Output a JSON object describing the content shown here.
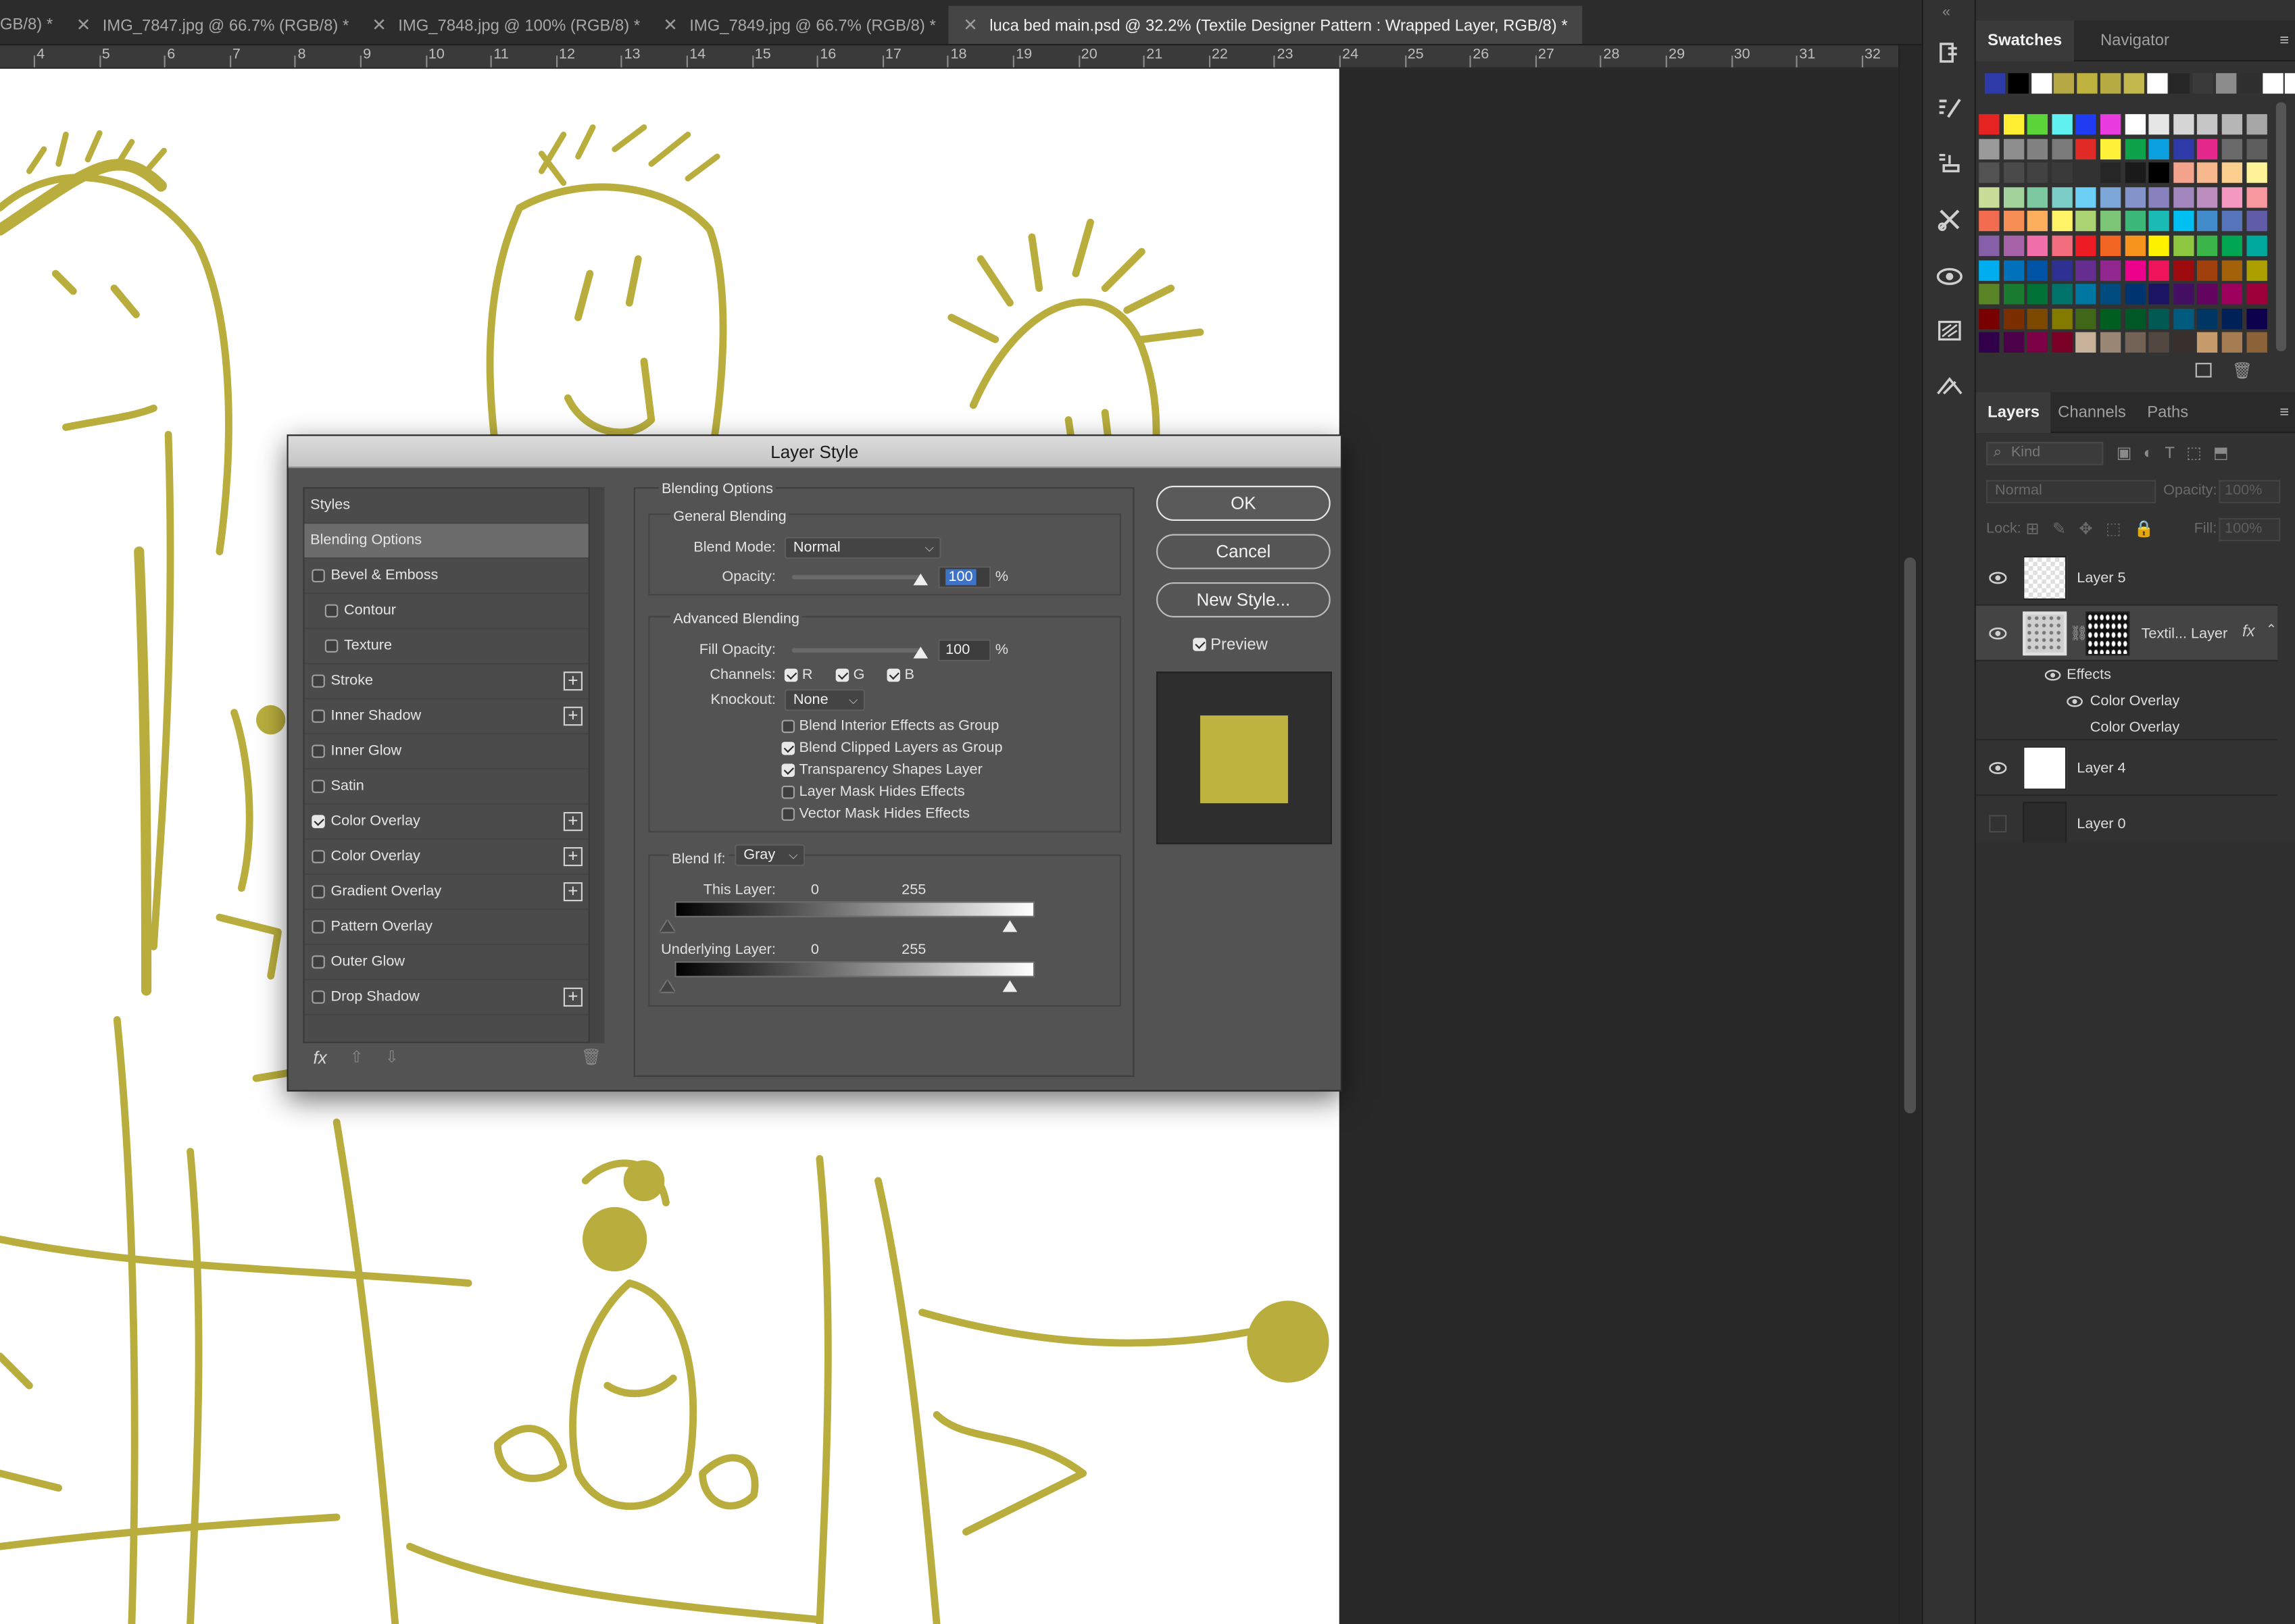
{
  "tabs": [
    {
      "label": "GB/8) *"
    },
    {
      "label": "IMG_7847.jpg @ 66.7% (RGB/8) *"
    },
    {
      "label": "IMG_7848.jpg @ 100% (RGB/8) *"
    },
    {
      "label": "IMG_7849.jpg @ 66.7% (RGB/8) *"
    },
    {
      "label": "luca bed main.psd @ 32.2% (Textile Designer Pattern : Wrapped Layer, RGB/8) *"
    }
  ],
  "ruler": [
    "4",
    "5",
    "6",
    "7",
    "8",
    "9",
    "10",
    "11",
    "12",
    "13",
    "14",
    "15",
    "16",
    "17",
    "18",
    "19",
    "20",
    "21",
    "22",
    "23",
    "24",
    "25",
    "26",
    "27",
    "28",
    "29",
    "30",
    "31",
    "32"
  ],
  "colors": {
    "drawing": "#b9ae3d",
    "overlay": "#bfb33f",
    "dialog_bg": "#535353",
    "panel_bg": "#323232"
  },
  "top_panel": {
    "tabs": [
      "Swatches",
      "Navigator"
    ]
  },
  "swatches": {
    "recent": [
      "#2d3aa8",
      "#000000",
      "#ffffff",
      "#b5a845",
      "#bfb33f",
      "#b7ab44",
      "#c2b84e",
      "#ffffff",
      "#262626",
      "#3a3a3a",
      "#8c8c8c",
      "#2f2f2f",
      "#ffffff",
      "#ffffff"
    ],
    "rows": [
      [
        "#e52421",
        "#ffee32",
        "#5bd43a",
        "#5ff0f0",
        "#1f3cf2",
        "#e93cdf",
        "#ffffff",
        "#e6e6e6",
        "#d6d6d6",
        "#c6c6c6",
        "#b6b6b6",
        "#a6a6a6"
      ],
      [
        "#9a9a9a",
        "#8e8e8e",
        "#828282",
        "#7a7a7a",
        "#df2a26",
        "#fff13a",
        "#0da34a",
        "#0aa0df",
        "#2d3aa8",
        "#e5298c",
        "#6a6a6a",
        "#5e5e5e"
      ],
      [
        "#525252",
        "#4a4a4a",
        "#424242",
        "#3a3a3a",
        "#323232",
        "#262626",
        "#1a1a1a",
        "#000000",
        "#f4a48c",
        "#f6b88c",
        "#fccf8e",
        "#fff39a"
      ],
      [
        "#c8de98",
        "#a2d39c",
        "#7cc9a0",
        "#7ccdc8",
        "#6dcff6",
        "#7da7d9",
        "#8493ca",
        "#8781bd",
        "#a187be",
        "#bc8dbf",
        "#f49ac1",
        "#f6989d"
      ],
      [
        "#f26c4f",
        "#f68e55",
        "#fbaf5c",
        "#fff467",
        "#acd372",
        "#7cc576",
        "#3bb878",
        "#1abbb4",
        "#00bff3",
        "#438ccb",
        "#5674b9",
        "#605ca8"
      ],
      [
        "#855fa8",
        "#a763a8",
        "#f06ea9",
        "#f26d7d",
        "#ed1c24",
        "#f26522",
        "#f7941d",
        "#fff200",
        "#8dc63f",
        "#39b54a",
        "#00a651",
        "#00a99d"
      ],
      [
        "#00aeef",
        "#0072bc",
        "#0054a6",
        "#2e3192",
        "#662d91",
        "#92278f",
        "#ec008c",
        "#ed145b",
        "#9e0b0f",
        "#a0410d",
        "#a36209",
        "#aba000"
      ],
      [
        "#598527",
        "#197b30",
        "#007236",
        "#00746b",
        "#0076a3",
        "#004b80",
        "#003471",
        "#1b1464",
        "#440e62",
        "#630460",
        "#9e005d",
        "#9e0039"
      ],
      [
        "#790000",
        "#7b2e00",
        "#7d4900",
        "#827b00",
        "#406618",
        "#005e20",
        "#005826",
        "#005952",
        "#005b7f",
        "#003663",
        "#002157",
        "#0d004c"
      ],
      [
        "#32004b",
        "#4b0049",
        "#7b0046",
        "#7a0026",
        "#c7b299",
        "#998675",
        "#736357",
        "#534741",
        "#37302d",
        "#c69c6d",
        "#a67c52",
        "#8c6239"
      ]
    ]
  },
  "layers_panel": {
    "tabs": [
      "Layers",
      "Channels",
      "Paths"
    ],
    "search_placeholder": "Kind",
    "blend_mode": "Normal",
    "opacity_label": "Opacity:",
    "opacity_value": "100%",
    "lock_label": "Lock:",
    "fill_label": "Fill:",
    "fill_value": "100%",
    "layers": [
      {
        "name": "Layer 5",
        "visible": true
      },
      {
        "name": "Textil... Layer",
        "visible": true
      },
      {
        "name": "Layer 4",
        "visible": true
      },
      {
        "name": "Layer 0",
        "visible": false
      }
    ],
    "effects_label": "Effects",
    "effects": [
      "Color Overlay",
      "Color Overlay"
    ],
    "fx": "fx"
  },
  "dialog": {
    "title": "Layer Style",
    "styles_header": "Styles",
    "styles": [
      {
        "label": "Blending Options",
        "checkbox": false,
        "checked": false,
        "plus": false,
        "indent": false,
        "selected": true
      },
      {
        "label": "Bevel & Emboss",
        "checkbox": true,
        "checked": false,
        "plus": false,
        "indent": false,
        "selected": false
      },
      {
        "label": "Contour",
        "checkbox": true,
        "checked": false,
        "plus": false,
        "indent": true,
        "selected": false
      },
      {
        "label": "Texture",
        "checkbox": true,
        "checked": false,
        "plus": false,
        "indent": true,
        "selected": false
      },
      {
        "label": "Stroke",
        "checkbox": true,
        "checked": false,
        "plus": true,
        "indent": false,
        "selected": false
      },
      {
        "label": "Inner Shadow",
        "checkbox": true,
        "checked": false,
        "plus": true,
        "indent": false,
        "selected": false
      },
      {
        "label": "Inner Glow",
        "checkbox": true,
        "checked": false,
        "plus": false,
        "indent": false,
        "selected": false
      },
      {
        "label": "Satin",
        "checkbox": true,
        "checked": false,
        "plus": false,
        "indent": false,
        "selected": false
      },
      {
        "label": "Color Overlay",
        "checkbox": true,
        "checked": true,
        "plus": true,
        "indent": false,
        "selected": false
      },
      {
        "label": "Color Overlay",
        "checkbox": true,
        "checked": false,
        "plus": true,
        "indent": false,
        "selected": false
      },
      {
        "label": "Gradient Overlay",
        "checkbox": true,
        "checked": false,
        "plus": true,
        "indent": false,
        "selected": false
      },
      {
        "label": "Pattern Overlay",
        "checkbox": true,
        "checked": false,
        "plus": false,
        "indent": false,
        "selected": false
      },
      {
        "label": "Outer Glow",
        "checkbox": true,
        "checked": false,
        "plus": false,
        "indent": false,
        "selected": false
      },
      {
        "label": "Drop Shadow",
        "checkbox": true,
        "checked": false,
        "plus": true,
        "indent": false,
        "selected": false
      }
    ],
    "fx": "fx",
    "blending_options": "Blending Options",
    "general_blending": "General Blending",
    "blend_mode_label": "Blend Mode:",
    "blend_mode": "Normal",
    "opacity_label": "Opacity:",
    "opacity": "100",
    "opacity_level": 1.0,
    "percent": "%",
    "advanced_blending": "Advanced Blending",
    "fill_opacity_label": "Fill Opacity:",
    "fill_opacity": "100",
    "fill_level": 1.0,
    "channels_label": "Channels:",
    "channels": [
      {
        "label": "R",
        "checked": true
      },
      {
        "label": "G",
        "checked": true
      },
      {
        "label": "B",
        "checked": true
      }
    ],
    "knockout_label": "Knockout:",
    "knockout": "None",
    "options": [
      {
        "label": "Blend Interior Effects as Group",
        "checked": false
      },
      {
        "label": "Blend Clipped Layers as Group",
        "checked": true
      },
      {
        "label": "Transparency Shapes Layer",
        "checked": true
      },
      {
        "label": "Layer Mask Hides Effects",
        "checked": false
      },
      {
        "label": "Vector Mask Hides Effects",
        "checked": false
      }
    ],
    "blend_if_label": "Blend If:",
    "blend_if": "Gray",
    "this_layer_label": "This Layer:",
    "this_layer": [
      "0",
      "255"
    ],
    "underlying_layer_label": "Underlying Layer:",
    "underlying_layer": [
      "0",
      "255"
    ],
    "ok": "OK",
    "cancel": "Cancel",
    "new_style": "New Style...",
    "preview_label": "Preview",
    "preview_checked": true
  }
}
